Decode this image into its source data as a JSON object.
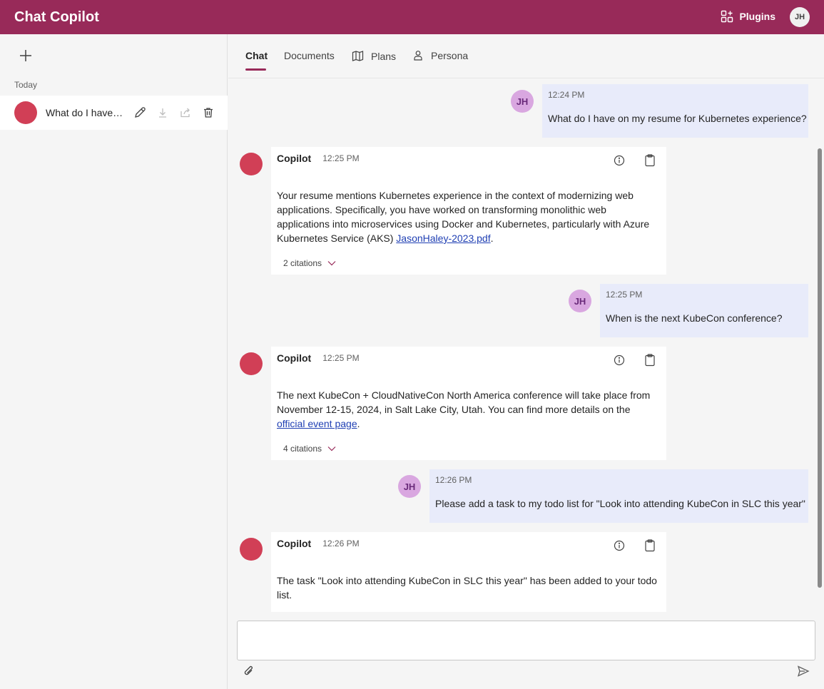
{
  "header": {
    "title": "Chat Copilot",
    "plugins_label": "Plugins",
    "avatar_initials": "JH"
  },
  "sidebar": {
    "section_label": "Today",
    "chats": [
      {
        "title": "What do I have on my resume for Kubernetes experience?"
      }
    ]
  },
  "tabs": [
    {
      "label": "Chat",
      "active": true
    },
    {
      "label": "Documents"
    },
    {
      "label": "Plans"
    },
    {
      "label": "Persona"
    }
  ],
  "messages": [
    {
      "role": "user",
      "initials": "JH",
      "time": "12:24 PM",
      "text": "What do I have on my resume for Kubernetes experience?"
    },
    {
      "role": "bot",
      "author": "Copilot",
      "time": "12:25 PM",
      "text_before_link": "Your resume mentions Kubernetes experience in the context of modernizing web applications. Specifically, you have worked on transforming monolithic web applications into microservices using Docker and Kubernetes, particularly with Azure Kubernetes Service (AKS) ",
      "link_text": "JasonHaley-2023.pdf",
      "text_after_link": ".",
      "citations_label": "2 citations"
    },
    {
      "role": "user",
      "initials": "JH",
      "time": "12:25 PM",
      "text": "When is the next KubeCon conference?"
    },
    {
      "role": "bot",
      "author": "Copilot",
      "time": "12:25 PM",
      "text_before_link": "The next KubeCon + CloudNativeCon North America conference will take place from November 12-15, 2024, in Salt Lake City, Utah. You can find more details on the ",
      "link_text": "official event page",
      "text_after_link": ".",
      "citations_label": "4 citations"
    },
    {
      "role": "user",
      "initials": "JH",
      "time": "12:26 PM",
      "text": "Please add a task to my todo list for \"Look into attending KubeCon in SLC this year\""
    },
    {
      "role": "bot",
      "author": "Copilot",
      "time": "12:26 PM",
      "text_before_link": "The task \"Look into attending KubeCon in SLC this year\" has been added to your todo list.",
      "link_text": "",
      "text_after_link": ""
    }
  ],
  "composer": {
    "value": "",
    "placeholder": ""
  },
  "colors": {
    "brand": "#982a59",
    "bot_avatar": "#d13f56",
    "user_bubble": "#e8ebfa",
    "user_avatar": "#d9a7e0"
  },
  "icons": {
    "new_chat": "plus-icon",
    "edit": "pencil-icon",
    "download": "download-icon",
    "share": "share-icon",
    "delete": "trash-icon",
    "info": "info-icon",
    "copy": "clipboard-icon",
    "attach": "paperclip-icon",
    "send": "send-icon",
    "plugins": "apps-add-icon",
    "plans": "map-icon",
    "persona": "person-icon"
  }
}
